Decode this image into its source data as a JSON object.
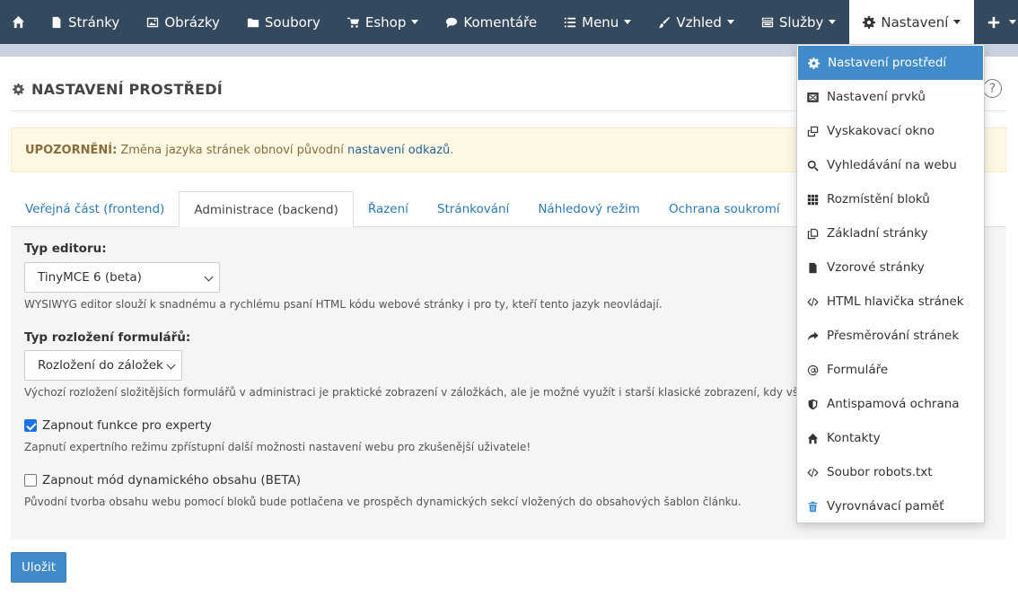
{
  "nav": {
    "items": [
      {
        "label": "Stránky",
        "icon": "page-icon"
      },
      {
        "label": "Obrázky",
        "icon": "image-icon"
      },
      {
        "label": "Soubory",
        "icon": "folder-icon"
      },
      {
        "label": "Eshop",
        "icon": "cart-icon"
      },
      {
        "label": "Komentáře",
        "icon": "comments-icon"
      },
      {
        "label": "Menu",
        "icon": "list-icon"
      },
      {
        "label": "Vzhled",
        "icon": "brush-icon"
      },
      {
        "label": "Služby",
        "icon": "services-icon"
      },
      {
        "label": "Nastavení",
        "icon": "gear-icon"
      }
    ]
  },
  "header": {
    "title": "NASTAVENÍ PROSTŘEDÍ",
    "help": "?"
  },
  "alert": {
    "strong": "UPOZORNĚNÍ:",
    "text": "Změna jazyka stránek obnoví původní",
    "link": "nastavení odkazů",
    "tail": "."
  },
  "tabs": [
    {
      "label": "Veřejná část (frontend)",
      "active": false
    },
    {
      "label": "Administrace (backend)",
      "active": true
    },
    {
      "label": "Řazení",
      "active": false
    },
    {
      "label": "Stránkování",
      "active": false
    },
    {
      "label": "Náhledový režim",
      "active": false
    },
    {
      "label": "Ochrana soukromí",
      "active": false
    }
  ],
  "form": {
    "editor_label": "Typ editoru:",
    "editor_value": "TinyMCE 6 (beta)",
    "editor_help": "WYSIWYG editor slouží k snadnému a rychlému psaní HTML kódu webové stránky i pro ty, kteří tento jazyk neovládají.",
    "layout_label": "Typ rozložení formulářů:",
    "layout_value": "Rozložení do záložek",
    "layout_help": "Výchozí rozložení složitějších formulářů v administraci je praktické zobrazení v záložkách, ale je možné využít i starší klasické zobrazení, kdy všechny části formu",
    "expert_label": "Zapnout funkce pro experty",
    "expert_checked": true,
    "expert_help": "Zapnutí expertního režimu zpřístupní další možnosti nastavení webu pro zkušenější uživatele!",
    "dynamic_label": "Zapnout mód dynamického obsahu (BETA)",
    "dynamic_checked": false,
    "dynamic_help": "Původní tvorba obsahu webu pomocí bloků bude potlačena ve prospěch dynamických sekcí vložených do obsahových šablon článku.",
    "save_label": "Uložit"
  },
  "dropdown": {
    "items": [
      {
        "label": "Nastavení prostředí",
        "icon": "gear-icon",
        "active": true
      },
      {
        "label": "Nastavení prvků",
        "icon": "elements-icon",
        "active": false
      },
      {
        "label": "Vyskakovací okno",
        "icon": "popup-icon",
        "active": false
      },
      {
        "label": "Vyhledávání na webu",
        "icon": "search-icon",
        "active": false
      },
      {
        "label": "Rozmístění bloků",
        "icon": "grid-icon",
        "active": false
      },
      {
        "label": "Základní stránky",
        "icon": "copy-icon",
        "active": false
      },
      {
        "label": "Vzorové stránky",
        "icon": "file-icon",
        "active": false
      },
      {
        "label": "HTML hlavička stránek",
        "icon": "code-icon",
        "active": false
      },
      {
        "label": "Přesměrování stránek",
        "icon": "redirect-icon",
        "active": false
      },
      {
        "label": "Formuláře",
        "icon": "at-icon",
        "active": false
      },
      {
        "label": "Antispamová ochrana",
        "icon": "shield-icon",
        "active": false
      },
      {
        "label": "Kontakty",
        "icon": "home-icon",
        "active": false
      },
      {
        "label": "Soubor robots.txt",
        "icon": "code-icon",
        "active": false
      },
      {
        "label": "Vyrovnávací paměť",
        "icon": "trash-icon",
        "active": false
      }
    ]
  },
  "colors": {
    "navbar": "#34495e",
    "accent": "#428bca",
    "alert_bg": "#fcf8e3",
    "link": "#2a7ab8"
  }
}
